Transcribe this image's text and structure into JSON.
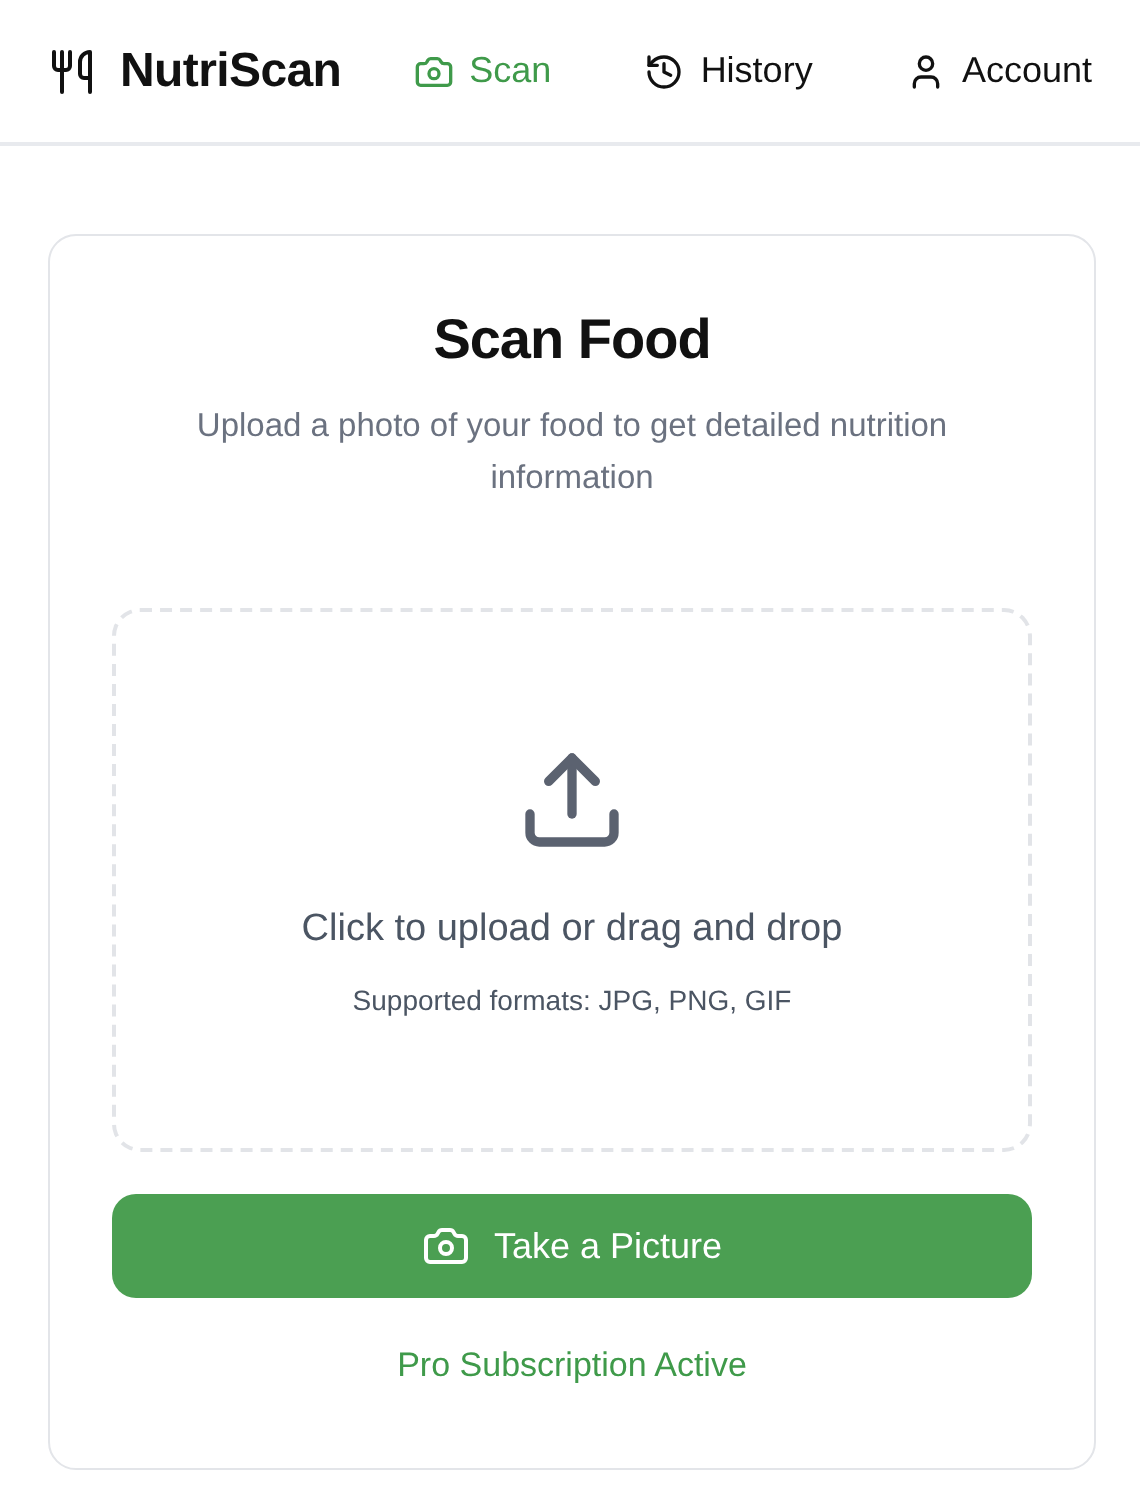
{
  "app": {
    "name": "NutriScan"
  },
  "nav": [
    {
      "kind": "scan",
      "label": "Scan",
      "selected": true
    },
    {
      "kind": "history",
      "label": "History",
      "selected": false
    },
    {
      "kind": "account",
      "label": "Account",
      "selected": false
    }
  ],
  "card": {
    "title": "Scan Food",
    "subtitle": "Upload a photo of your food to get detailed nutrition information"
  },
  "dropzone": {
    "prompt": "Click to upload or drag and drop",
    "hint": "Supported formats: JPG, PNG, GIF"
  },
  "camera_button": {
    "label": "Take a Picture"
  },
  "status": "Pro Subscription Active"
}
